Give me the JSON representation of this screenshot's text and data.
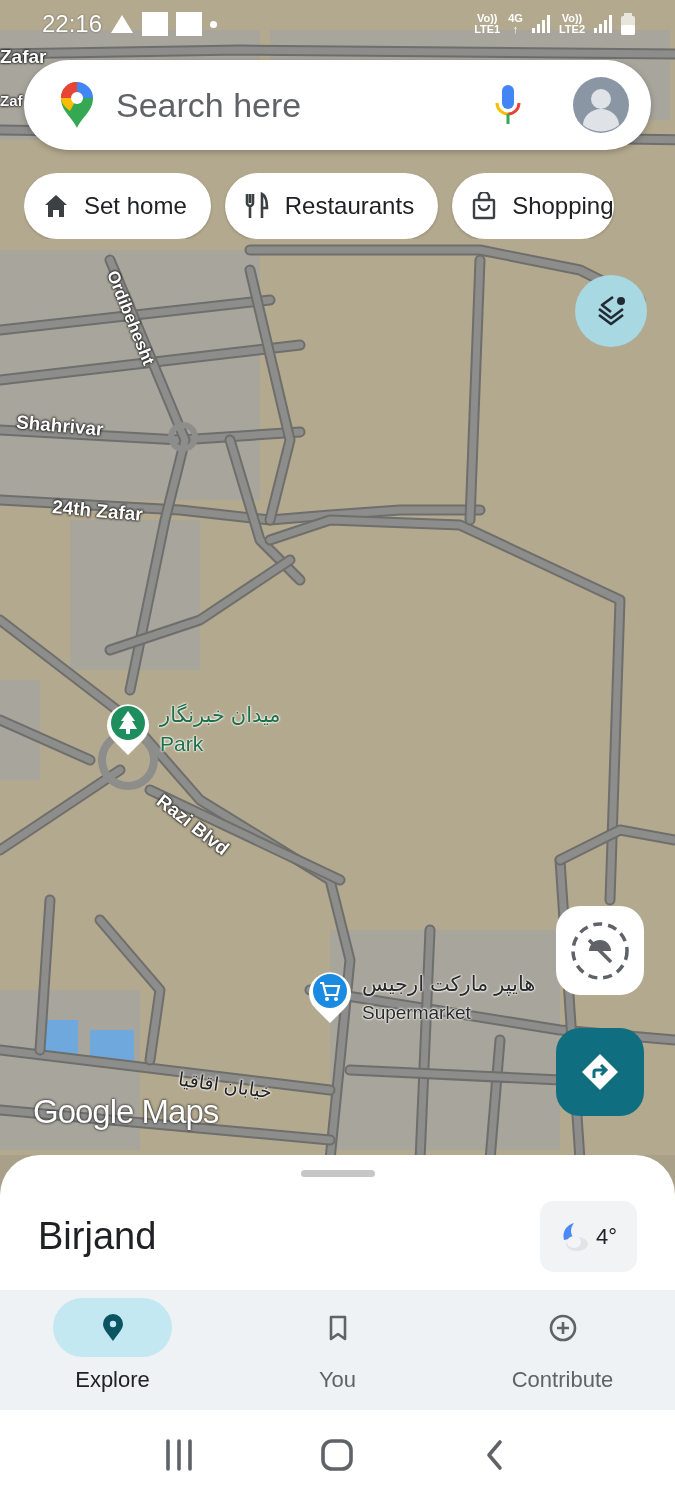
{
  "status_bar": {
    "time": "22:16",
    "networks": [
      {
        "top": "Vo))",
        "bottom": "LTE1"
      },
      {
        "top": "4G",
        "bottom": "↑"
      },
      {
        "top": "Vo))",
        "bottom": "LTE2"
      }
    ]
  },
  "search": {
    "placeholder": "Search here"
  },
  "chips": [
    {
      "label": "Set home",
      "kind": "home"
    },
    {
      "label": "Restaurants",
      "kind": "restaurant"
    },
    {
      "label": "Shopping",
      "kind": "shopping"
    }
  ],
  "map": {
    "road_labels": [
      "Zafar",
      "Zaf",
      "Ordibehesht",
      "Shahrivar",
      "24th Zafar",
      "Razi Blvd",
      "خیابان اقاقیا"
    ],
    "places": [
      {
        "name": "میدان خبرنگار",
        "category": "Park",
        "kind": "park"
      },
      {
        "name": "هایپر مارکت ارجیس",
        "category": "Supermarket",
        "kind": "supermarket"
      }
    ],
    "logo": "Google Maps"
  },
  "sheet": {
    "title": "Birjand",
    "weather": "4°"
  },
  "nav": [
    {
      "label": "Explore",
      "kind": "explore",
      "selected": true
    },
    {
      "label": "You",
      "kind": "you",
      "selected": false
    },
    {
      "label": "Contribute",
      "kind": "contribute",
      "selected": false
    }
  ]
}
